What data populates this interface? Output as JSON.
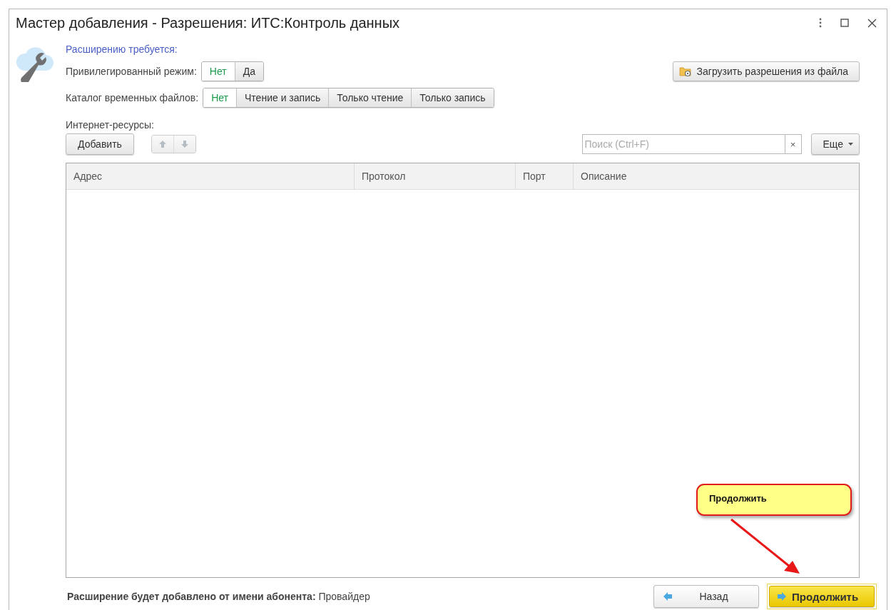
{
  "window": {
    "title": "Мастер добавления - Разрешения: ИТС:Контроль данных"
  },
  "requirement_heading": "Расширению требуется:",
  "privileged_mode": {
    "label": "Привилегированный режим:",
    "options": [
      {
        "label": "Нет",
        "selected": true
      },
      {
        "label": "Да",
        "selected": false
      }
    ]
  },
  "load_button": "Загрузить разрешения из файла",
  "temp_catalog": {
    "label": "Каталог временных файлов:",
    "options": [
      {
        "label": "Нет",
        "selected": true
      },
      {
        "label": "Чтение и запись",
        "selected": false
      },
      {
        "label": "Только чтение",
        "selected": false
      },
      {
        "label": "Только запись",
        "selected": false
      }
    ]
  },
  "internet_resources": {
    "label": "Интернет-ресурсы:",
    "add_button": "Добавить",
    "search": {
      "placeholder": "Поиск (Ctrl+F)",
      "clear": "×"
    },
    "more_button": "Еще"
  },
  "table": {
    "columns": [
      "Адрес",
      "Протокол",
      "Порт",
      "Описание"
    ]
  },
  "footer": {
    "text": "**Расширение будет добавлено от имени абонента:** Провайдер",
    "back_button": "Назад",
    "next_button": "Продолжить"
  },
  "callout": {
    "text": "Продолжить"
  }
}
